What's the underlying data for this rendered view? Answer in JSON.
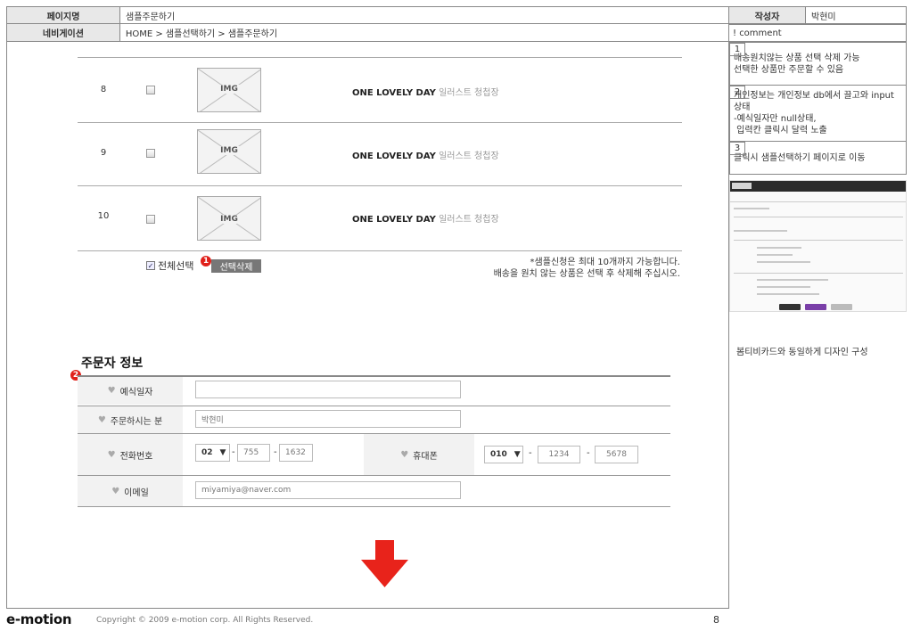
{
  "header": {
    "page_name_label": "페이지명",
    "page_name": "샘플주문하기",
    "author_label": "작성자",
    "author": "박현미",
    "nav_label": "네비게이션",
    "nav_path": "HOME > 샘플선택하기 > 샘플주문하기",
    "comment_label": "! comment"
  },
  "comments": [
    {
      "num": "1",
      "lines": [
        "배송원치않는 상품 선택 삭제 가능",
        "선택한 상품만 주문할 수 있음"
      ]
    },
    {
      "num": "2",
      "lines": [
        "개인정보는 개인정보 db에서 끌고와 input상태",
        "-예식일자만 null상태,",
        " 입력칸 클릭시 달력 노출"
      ]
    },
    {
      "num": "3",
      "lines": [
        "클릭시 샘플선택하기 페이지로 이동"
      ]
    }
  ],
  "thumbnail_caption": "봄티비카드와 동일하게 디자인 구성",
  "products": [
    {
      "num": "8",
      "img": "IMG",
      "title": "ONE LOVELY DAY",
      "subtitle": "일러스트 청첩장"
    },
    {
      "num": "9",
      "img": "IMG",
      "title": "ONE LOVELY DAY",
      "subtitle": "일러스트 청첩장"
    },
    {
      "num": "10",
      "img": "IMG",
      "title": "ONE LOVELY DAY",
      "subtitle": "일러스트 청첩장"
    }
  ],
  "select_all_label": "전체선택",
  "delete_selected_label": "선택삭제",
  "badges": {
    "one": "1",
    "two": "2"
  },
  "notice": {
    "line1": "*샘플신청은 최대 10개까지 가능합니다.",
    "line2": "배송을 원치 않는 상품은 선택 후 삭제해 주십시오."
  },
  "orderer_section": {
    "title": "주문자 정보",
    "wedding_date_label": "예식일자",
    "wedding_date_value": "",
    "orderer_label": "주문하시는 분",
    "orderer_value": "박현미",
    "phone_label": "전화번호",
    "phone_area": "02",
    "phone_mid": "755",
    "phone_last": "1632",
    "mobile_label": "휴대폰",
    "mobile_prefix": "010",
    "mobile_mid": "1234",
    "mobile_last": "5678",
    "email_label": "이메일",
    "email_value": "miyamiya@naver.com"
  },
  "colors": {
    "accent_red": "#e8231b",
    "badge_red": "#e0201a"
  },
  "footer": {
    "logo": "e-motion",
    "copyright": "Copyright © 2009 e-motion corp. All Rights Reserved.",
    "page_number": "8"
  }
}
